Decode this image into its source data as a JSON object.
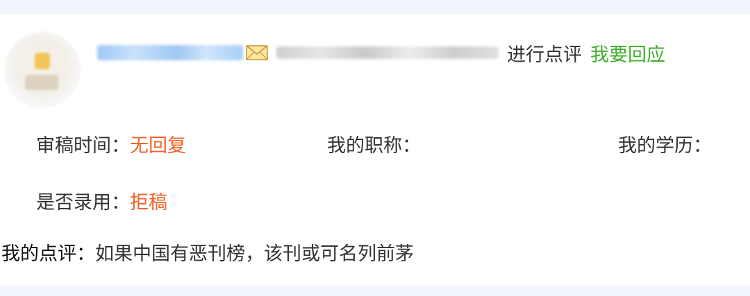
{
  "header": {
    "action_text": "进行点评",
    "reply_link": "我要回应"
  },
  "icons": {
    "mail": "mail-icon"
  },
  "colors": {
    "value_orange": "#f06428",
    "link_green": "#3fae2b",
    "band": "#f2f6fc"
  },
  "fields": {
    "review_time": {
      "label": "审稿时间：",
      "value": "无回复"
    },
    "title": {
      "label": "我的职称：",
      "value": ""
    },
    "education": {
      "label": "我的学历：",
      "value": ""
    },
    "accepted": {
      "label": "是否录用：",
      "value": "拒稿"
    }
  },
  "comment": {
    "label": "我的点评：",
    "text": "如果中国有恶刊榜，该刊或可名列前茅"
  }
}
